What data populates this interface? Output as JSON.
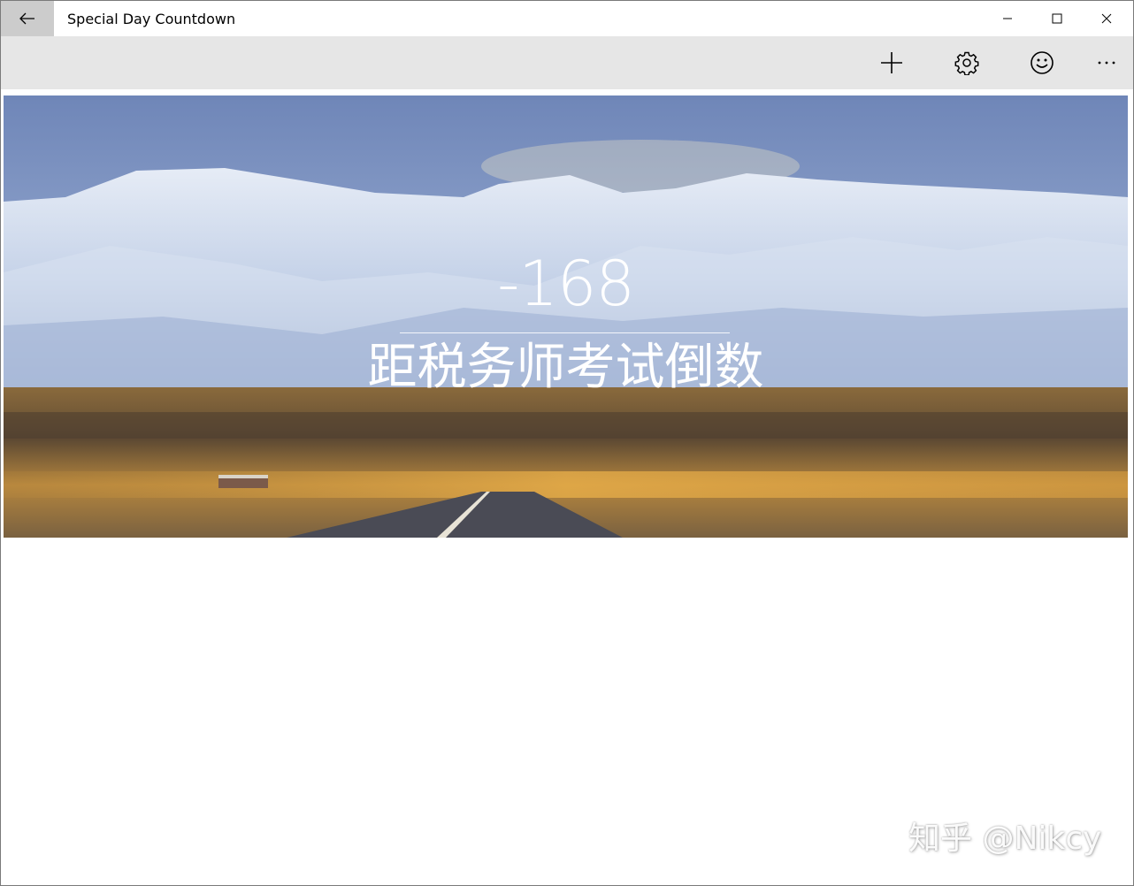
{
  "window": {
    "title": "Special Day Countdown"
  },
  "toolbar": {
    "icons": [
      "add-icon",
      "settings-icon",
      "smiley-icon",
      "more-icon"
    ]
  },
  "countdown": {
    "value": "-168",
    "title": "距税务师考试倒数"
  },
  "watermark": {
    "text": "知乎 @Nikcy"
  },
  "colors": {
    "titlebar_bg": "#ffffff",
    "back_button_bg": "#cccccc",
    "commandbar_bg": "#e6e6e6",
    "text_on_image": "#ffffff"
  }
}
